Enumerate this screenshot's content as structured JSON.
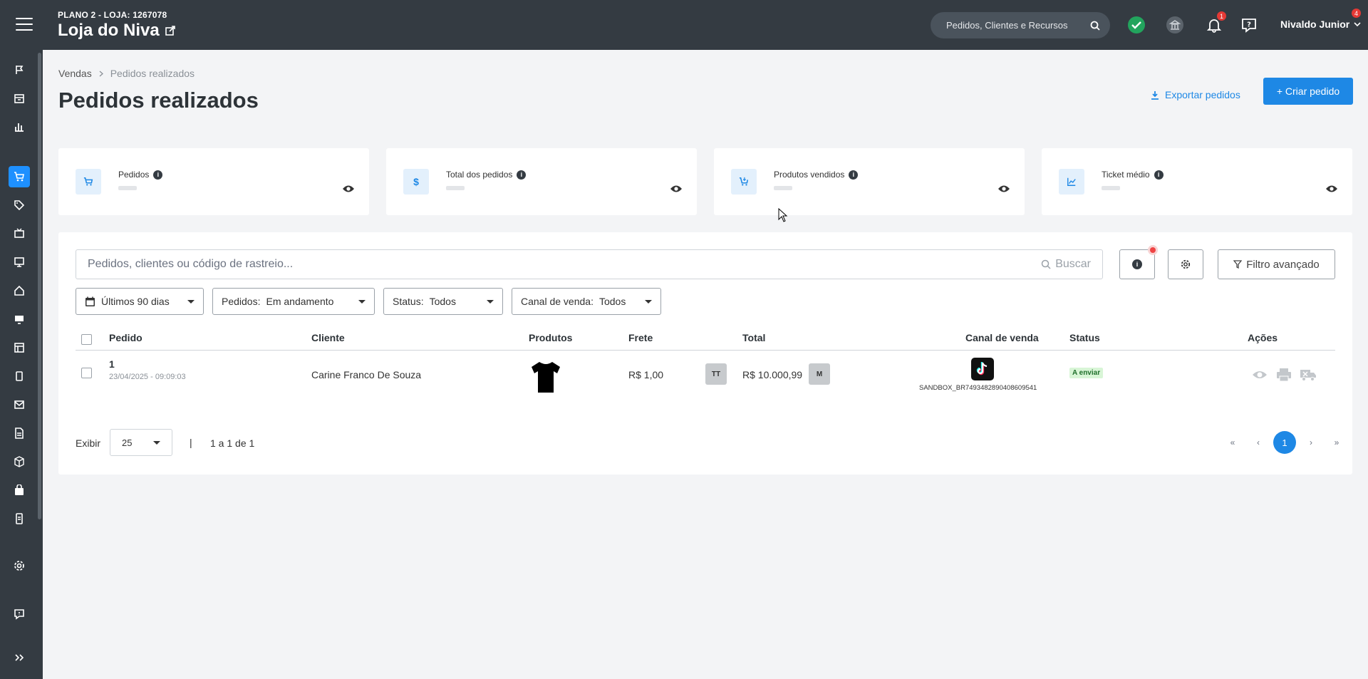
{
  "header": {
    "plan": "PLANO 2 - LOJA: 1267078",
    "store_name": "Loja do Niva",
    "search_placeholder": "Pedidos, Clientes e Recursos",
    "notifications_count": "1",
    "user_name": "Nivaldo Junior",
    "user_badge": "4"
  },
  "sidebar": {
    "items": [
      "flag",
      "store",
      "chart",
      "cart",
      "tag",
      "tv",
      "monitor",
      "home",
      "display",
      "layout",
      "tablet",
      "mail",
      "document",
      "box",
      "bag",
      "receipt",
      "settings",
      "feedback",
      "expand"
    ],
    "active": "cart"
  },
  "breadcrumb": {
    "root": "Vendas",
    "current": "Pedidos realizados"
  },
  "page": {
    "title": "Pedidos realizados",
    "export_label": "Exportar pedidos",
    "create_label": "+ Criar pedido"
  },
  "stats": [
    {
      "label": "Pedidos",
      "icon": "cart-icon"
    },
    {
      "label": "Total dos pedidos",
      "icon": "dollar-icon"
    },
    {
      "label": "Produtos vendidos",
      "icon": "cart-down-icon"
    },
    {
      "label": "Ticket médio",
      "icon": "trend-icon"
    }
  ],
  "filters": {
    "search_placeholder": "Pedidos, clientes ou código de rastreio...",
    "search_button": "Buscar",
    "advanced_label": "Filtro avançado",
    "period": "Últimos 90 dias",
    "orders_label": "Pedidos:",
    "orders_value": "Em andamento",
    "status_label": "Status:",
    "status_value": "Todos",
    "channel_label": "Canal de venda:",
    "channel_value": "Todos"
  },
  "table": {
    "columns": [
      "Pedido",
      "Cliente",
      "Produtos",
      "Frete",
      "Total",
      "Canal de venda",
      "Status",
      "Ações"
    ],
    "rows": [
      {
        "order": "1",
        "date": "23/04/2025 - 09:09:03",
        "client": "Carine Franco De Souza",
        "freight": "R$ 1,00",
        "freight_tag": "TT",
        "total": "R$ 10.000,99",
        "total_tag": "M",
        "channel_code": "SANDBOX_BR7493482890408609541",
        "status": "A enviar"
      }
    ]
  },
  "pagination": {
    "show_label": "Exibir",
    "page_size": "25",
    "separator": "|",
    "range": "1 a 1 de 1",
    "first": "«",
    "prev": "‹",
    "current": "1",
    "next": "›",
    "last": "»"
  },
  "colors": {
    "topbar": "#343b42",
    "primary": "#1e88e5",
    "status_green": "#d8f5d6"
  }
}
